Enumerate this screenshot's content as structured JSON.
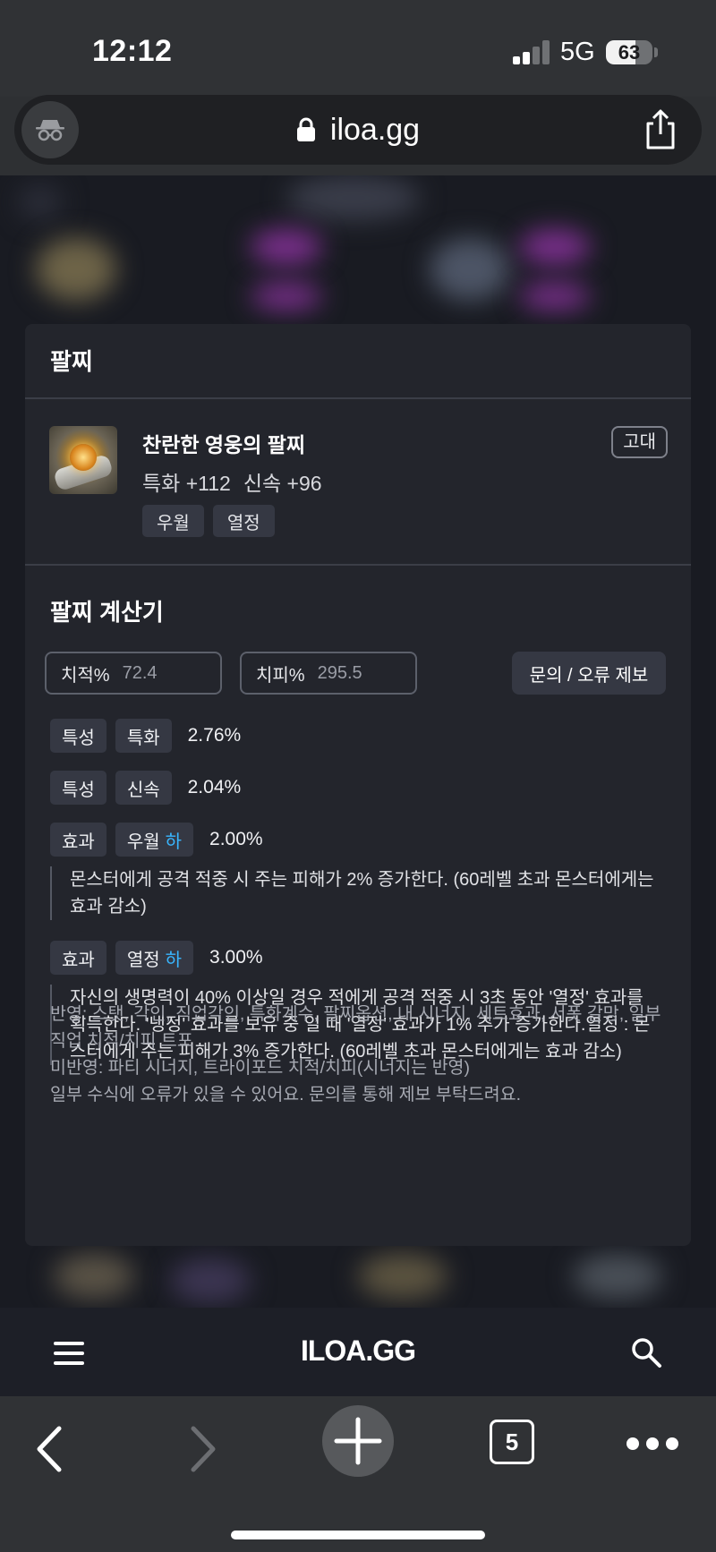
{
  "status_bar": {
    "time": "12:12",
    "network": "5G",
    "battery": 63,
    "battery_label": "63"
  },
  "browser": {
    "url": "iloa.gg",
    "tab_count": "5"
  },
  "modal": {
    "title": "팔찌",
    "item": {
      "name": "찬란한 영웅의 팔찌",
      "stats": [
        "특화 +112",
        "신속 +96"
      ],
      "tags": [
        "우월",
        "열정"
      ],
      "grade": "고대"
    },
    "calculator": {
      "title": "팔찌 계산기",
      "crit_rate_label": "치적%",
      "crit_rate_placeholder": "72.4",
      "crit_dmg_label": "치피%",
      "crit_dmg_placeholder": "295.5",
      "report_button": "문의 / 오류 제보",
      "rows": [
        {
          "type": "특성",
          "name": "특화",
          "level": "",
          "value": "2.76%"
        },
        {
          "type": "특성",
          "name": "신속",
          "level": "",
          "value": "2.04%"
        },
        {
          "type": "효과",
          "name": "우월",
          "level": "하",
          "value": "2.00%",
          "description": "몬스터에게 공격 적중 시 주는 피해가 2% 증가한다. (60레벨 초과 몬스터에게는 효과 감소)"
        },
        {
          "type": "효과",
          "name": "열정",
          "level": "하",
          "value": "3.00%",
          "description": "자신의 생명력이 40% 이상일 경우 적에게 공격 적중 시 3초 동안 '열정' 효과를 획득한다. '냉정' 효과를 보유 중 일 때 '열정' 효과가 1% 추가 증가한다.열정 : 몬스터에게 주는 피해가 3% 증가한다. (60레벨 초과 몬스터에게는 효과 감소)"
        }
      ],
      "notes": [
        "반영: 스탯, 각인, 직업각인, 특화계수, 팔찌옵션, 내 시너지, 세트효과, 서폿 갈망, 일부 직업 치적/치피 트포",
        "미반영: 파티 시너지, 트라이포드 치적/치피(시너지는 반영)",
        "일부 수식에 오류가 있을 수 있어요. 문의를 통해 제보 부탁드려요."
      ]
    }
  },
  "site_nav": {
    "logo": "ILOA.GG",
    "menu_icon": "hamburger-icon",
    "search_icon": "search-icon"
  },
  "colors": {
    "accent_level": "#38b6ff",
    "modal_bg": "#23252c",
    "chip_bg": "#353843"
  }
}
